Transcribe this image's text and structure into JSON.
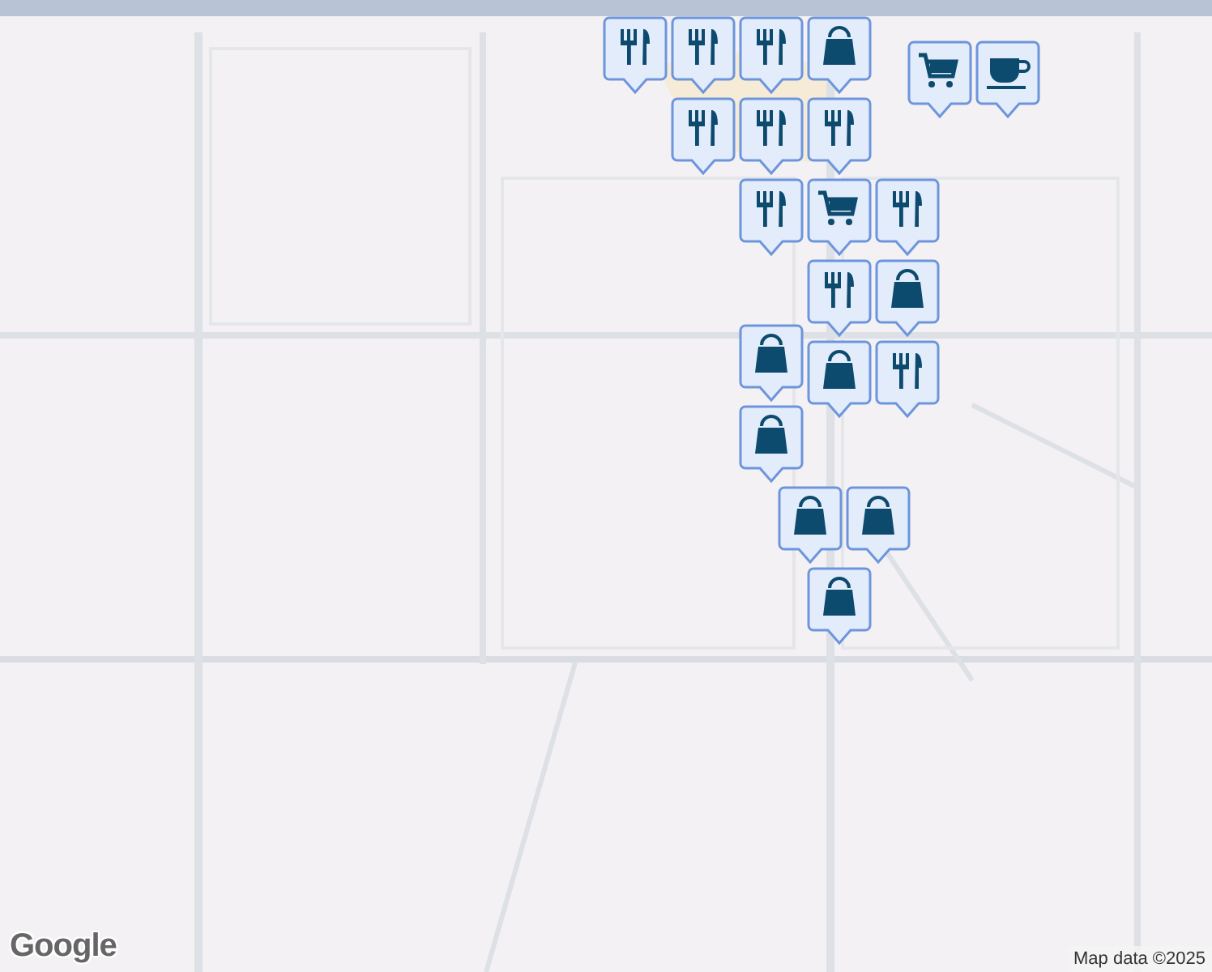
{
  "pins": [
    {
      "kind": "dining"
    },
    {
      "kind": "dining"
    },
    {
      "kind": "dining"
    },
    {
      "kind": "dining"
    },
    {
      "kind": "dining"
    },
    {
      "kind": "shopping"
    },
    {
      "kind": "dining"
    },
    {
      "kind": "grocery"
    },
    {
      "kind": "dining"
    },
    {
      "kind": "grocery"
    },
    {
      "kind": "cafe"
    },
    {
      "kind": "dining"
    },
    {
      "kind": "dining"
    },
    {
      "kind": "shopping"
    },
    {
      "kind": "dining"
    },
    {
      "kind": "shopping"
    },
    {
      "kind": "shopping"
    },
    {
      "kind": "shopping"
    },
    {
      "kind": "shopping"
    },
    {
      "kind": "shopping"
    },
    {
      "kind": "shopping"
    }
  ],
  "logo": "Google",
  "attribution": "Map data ©2025"
}
